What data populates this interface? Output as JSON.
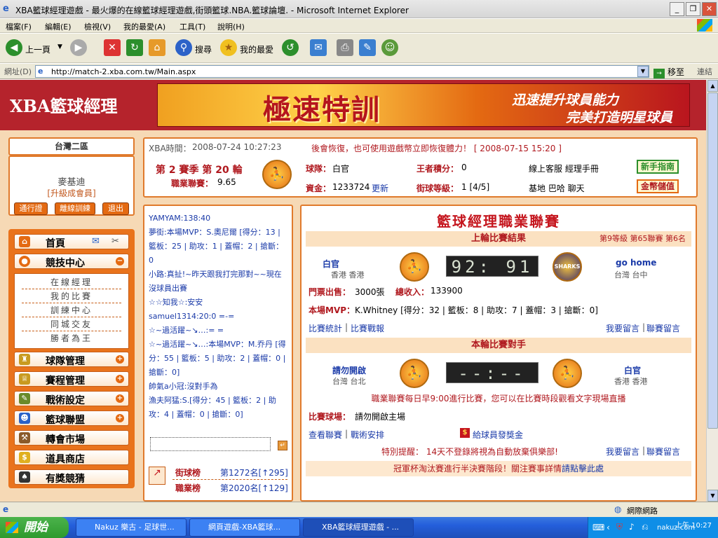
{
  "window": {
    "title": "XBA籃球經理遊戲 - 最火爆的在線籃球經理遊戲,街頭籃球.NBA.籃球論壇. - Microsoft Internet Explorer",
    "minimize": "_",
    "restore": "❐",
    "close": "✕"
  },
  "menu": [
    "檔案(F)",
    "編輯(E)",
    "檢視(V)",
    "我的最愛(A)",
    "工具(T)",
    "說明(H)"
  ],
  "toolbar": {
    "back": "上一頁",
    "search": "搜尋",
    "favorites": "我的最愛"
  },
  "address": {
    "label": "網址(D)",
    "url": "http://match-2.xba.com.tw/Main.aspx",
    "go": "移至",
    "links": "連結"
  },
  "header": {
    "logo": "XBA籃球經理",
    "banner_title": "極速特訓",
    "banner_sub1": "迅速提升球員能力",
    "banner_sub2": "完美打造明星球員"
  },
  "server": "台灣二區",
  "user": {
    "name": "麥基迪",
    "level": "[升級成會員]",
    "buttons": [
      "通行證",
      "離線訓練",
      "退出"
    ]
  },
  "nav": {
    "home": "首頁",
    "competition": "競技中心",
    "sub": [
      "在線經理",
      "我的比賽",
      "訓練中心",
      "同城交友",
      "勝者為王"
    ],
    "items": [
      "球隊管理",
      "賽程管理",
      "戰術設定",
      "籃球聯盟",
      "轉會市場",
      "道具商店",
      "有獎競猜"
    ]
  },
  "info": {
    "time_label": "XBA時間：",
    "time": "2008-07-24 10:27:23",
    "notice": "後會恢復，也可使用遊戲幣立即恢復體力！ [ 2008-07-15 15:20 ]",
    "season": "第 2 賽季 第 20 輪",
    "league_label": "職業聯賽：",
    "league_value": "9.65",
    "team_label": "球隊：",
    "team": "白官",
    "king_label": "王者積分：",
    "king": "0",
    "service": "線上客服 經理手冊",
    "guide_btn": "新手指南",
    "funds_label": "資金：",
    "funds": "1233724",
    "update": "更新",
    "street_label": "街球等級：",
    "street": "1 [4/5]",
    "base": "基地 巴哈 聊天",
    "gold_btn": "金幣儲值"
  },
  "chat": {
    "lines": [
      "YAMYAM:138:40",
      "夢街:本場MVP：S.奧尼爾 [得分：13 | 籃板：25 | 助攻：1 | 蓋帽：2 | 搶斷：0",
      "小路:真扯!~昨天跟我打完那對~~現在沒球員出賽",
      "☆☆知我☆:安安",
      "samuel1314:20:0 =-=",
      "☆~過活躍~↘…:= =",
      "☆~過活躍~↘…:本場MVP：M.乔丹 [得分：55 | 籃板：5 | 助攻：2 | 蓋帽：0 | 搶斷：0]",
      "帥氣a小冠:沒對手為",
      "漁夫阿猛:S.[得分：45 | 籃板：2 | 助攻：4 | 蓋帽：0 | 搶斷：0]"
    ],
    "send": "↵",
    "rank1_label": "街球榜",
    "rank1_value": "第1272名[↑295]",
    "rank2_label": "職業榜",
    "rank2_value": "第2020名[↑129]"
  },
  "league": {
    "title": "籃球經理職業聯賽",
    "last_result_label": "上輪比賽結果",
    "rank_info": "第9等級 第65聯賽 第6名",
    "home_team": "白官",
    "home_city": "香港 香港",
    "score": "92: 91",
    "away_team": "go home",
    "away_city": "台灣 台中",
    "away_logo": "SHARKS",
    "tickets_label": "門票出售：",
    "tickets": "3000張",
    "income_label": "總收入：",
    "income": "133900",
    "mvp_label": "本場MVP：",
    "mvp": "K.Whitney [得分：32 | 籃板：8 | 助攻：7 | 蓋帽：3 | 搶斷：0]",
    "stats_link": "比賽統計",
    "report_link": "比賽戰報",
    "comment_link": "我要留言",
    "league_comment_link": "聯賽留言",
    "next_label": "本輪比賽對手",
    "next_home": "請勿開啟",
    "next_home_city": "台灣 台北",
    "next_score": "--:--",
    "next_away": "白官",
    "next_away_city": "香港 香港",
    "schedule_note": "職業聯賽每日早9:00進行比賽，您可以在比賽時段觀看文字現場直播",
    "venue_label": "比賽球場：",
    "venue": "請勿開啟主場",
    "view_league": "查看聯賽",
    "tactics": "戰術安排",
    "bonus": "給球員發獎金",
    "reminder": "特別提醒： 14天不登錄將視為自動放棄俱樂部!",
    "comment2": "我要留言",
    "league_comment2": "聯賽留言",
    "cup_notice": "冠軍杯淘汰賽進行半決賽階段！關注賽事詳情",
    "cup_link": "請點擊此處"
  },
  "status": {
    "zone": "網際網路"
  },
  "taskbar": {
    "start": "開始",
    "tasks": [
      "Nakuz 樂古 - 足球世...",
      "網頁遊戲-XBA籃球...",
      "XBA籃球經理遊戲 - ..."
    ],
    "clock": "上午 10:27",
    "watermark": "nakuz.com"
  }
}
